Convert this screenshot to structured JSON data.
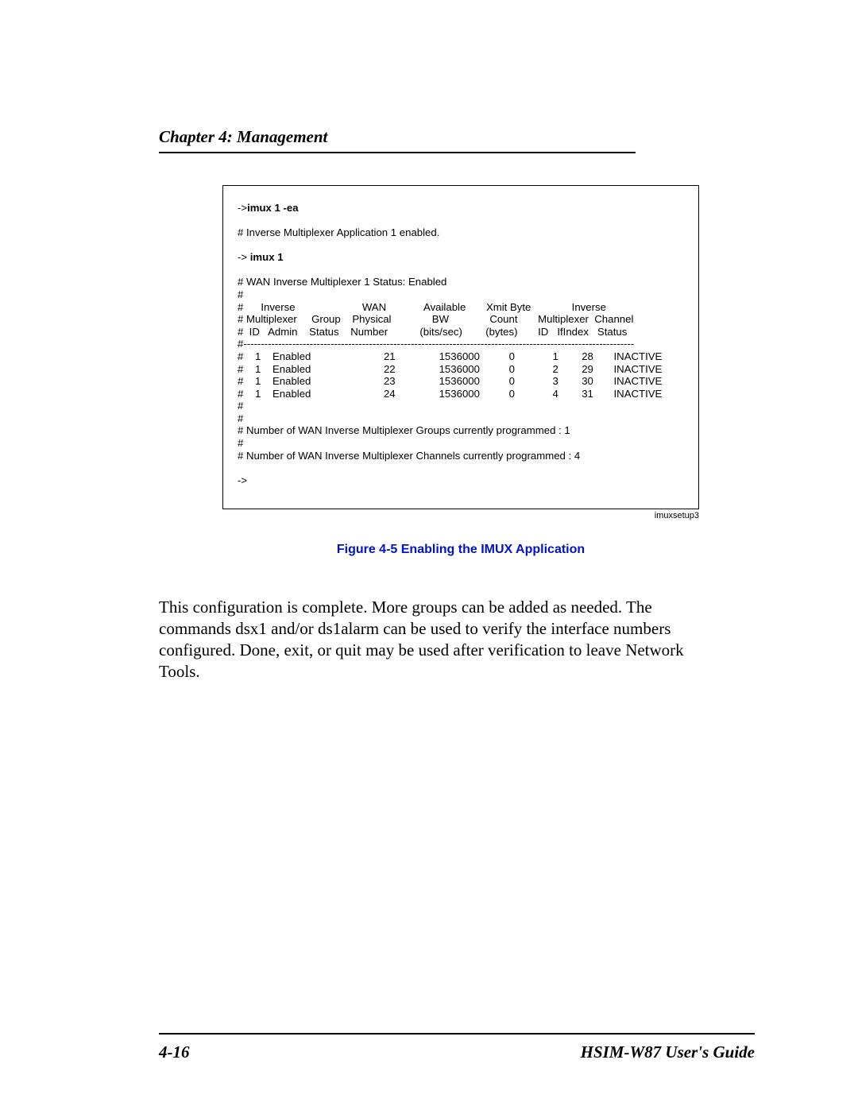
{
  "header": {
    "chapter_label": "Chapter 4:",
    "chapter_title": " Management"
  },
  "terminal": {
    "cmd1_prefix": "->",
    "cmd1_bold": "imux 1 -ea",
    "line2": "# Inverse Multiplexer Application 1 enabled.",
    "cmd2_prefix": "-> ",
    "cmd2_bold": "imux 1",
    "status_line": "# WAN Inverse Multiplexer 1 Status: Enabled",
    "hash_only": "#",
    "header_row1": "#      Inverse                       WAN             Available       Xmit Byte              Inverse",
    "header_row2": "# Multiplexer     Group    Physical              BW              Count       Multiplexer  Channel",
    "header_row3": "#  ID   Admin    Status    Number           (bits/sec)        (bytes)       ID   IfIndex   Status",
    "divider": "#----------------------------------------------------------------------------------------------------------------",
    "rows": [
      "#    1    Enabled                         21               1536000          0             1        28       INACTIVE",
      "#    1    Enabled                         22               1536000          0             2        29       INACTIVE",
      "#    1    Enabled                         23               1536000          0             3        30       INACTIVE",
      "#    1    Enabled                         24               1536000          0             4        31       INACTIVE"
    ],
    "groups_line": "# Number of WAN Inverse Multiplexer Groups currently programmed : 1",
    "channels_line": "# Number of WAN Inverse Multiplexer Channels currently programmed : 4",
    "prompt": "->"
  },
  "fig_label_small": "imuxsetup3",
  "figure_caption": "Figure 4-5    Enabling the IMUX Application",
  "body_paragraph": "This configuration is complete. More groups can be added as needed. The commands dsx1 and/or ds1alarm can be used to verify the interface numbers configured. Done, exit, or quit may be used after verification to leave Network Tools.",
  "footer": {
    "page_num": "4-16",
    "guide_title": "HSIM-W87 User's Guide"
  },
  "chart_data": {
    "type": "table",
    "title": "WAN Inverse Multiplexer 1 Status: Enabled",
    "columns": [
      "Inverse Multiplexer ID",
      "Admin",
      "Group Status",
      "WAN Physical Number",
      "Available BW (bits/sec)",
      "Xmit Byte Count (bytes)",
      "Inverse Multiplexer ID",
      "Channel IfIndex",
      "Channel Status"
    ],
    "rows": [
      [
        1,
        "Enabled",
        "",
        21,
        1536000,
        0,
        1,
        28,
        "INACTIVE"
      ],
      [
        1,
        "Enabled",
        "",
        22,
        1536000,
        0,
        2,
        29,
        "INACTIVE"
      ],
      [
        1,
        "Enabled",
        "",
        23,
        1536000,
        0,
        3,
        30,
        "INACTIVE"
      ],
      [
        1,
        "Enabled",
        "",
        24,
        1536000,
        0,
        4,
        31,
        "INACTIVE"
      ]
    ],
    "summary": {
      "groups_programmed": 1,
      "channels_programmed": 4
    }
  }
}
